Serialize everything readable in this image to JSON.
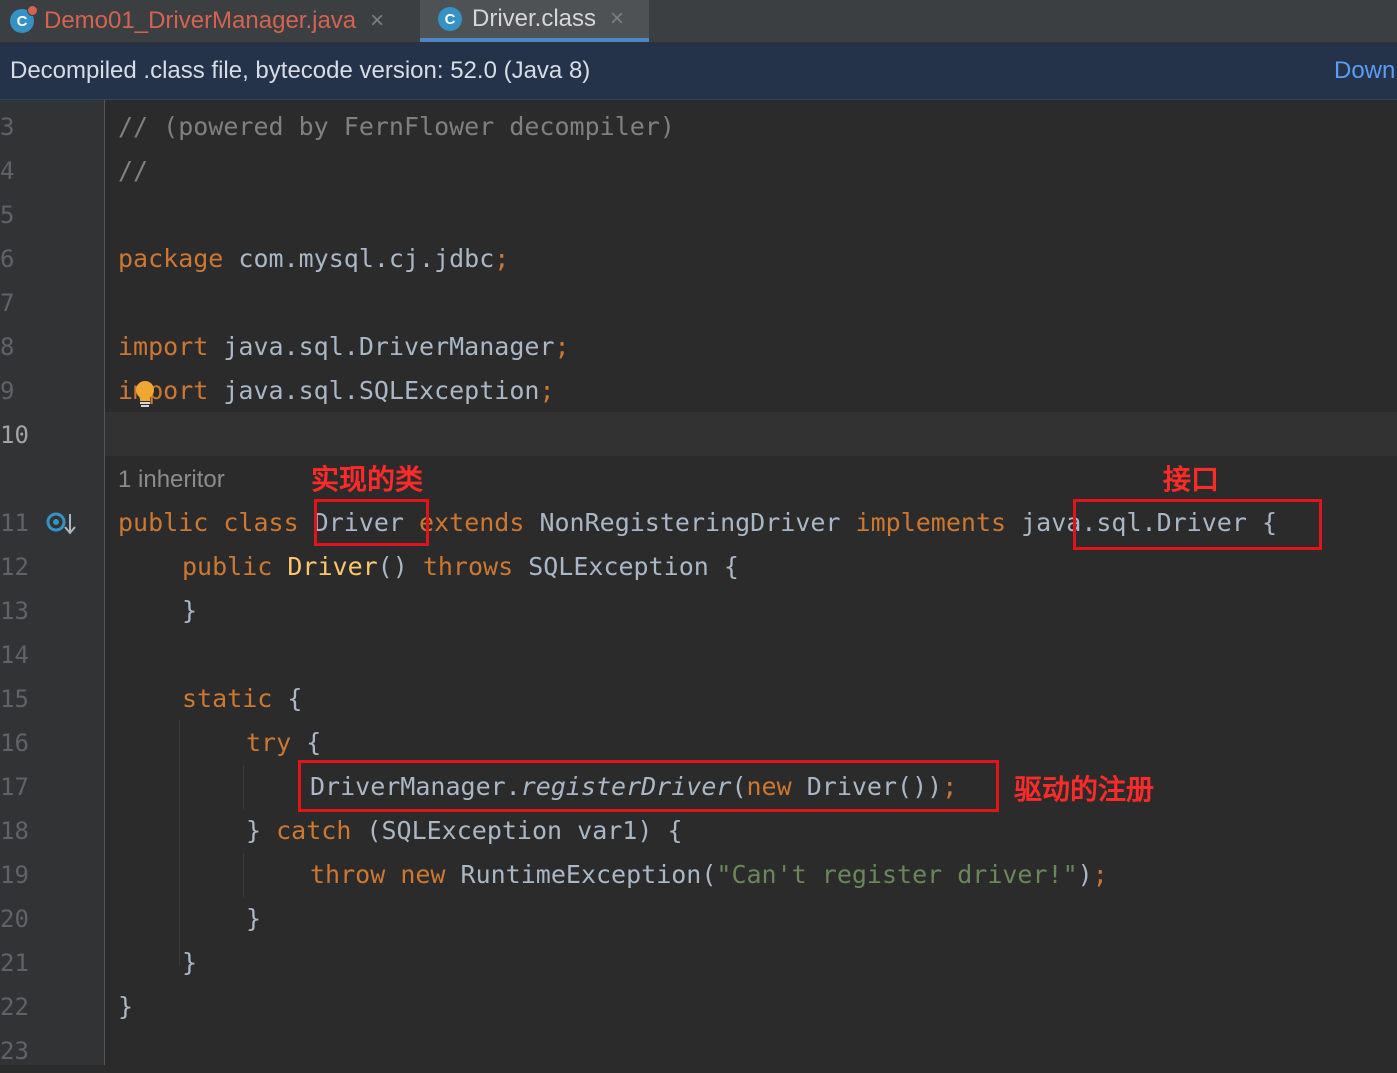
{
  "tabs": [
    {
      "label": "Demo01_DriverManager.java",
      "icon": "java-class-icon",
      "close": "×"
    },
    {
      "label": "Driver.class",
      "icon": "class-icon",
      "close": "×"
    }
  ],
  "banner": {
    "text": "Decompiled .class file, bytecode version: 52.0 (Java 8)",
    "link": "Down"
  },
  "line_numbers": [
    "3",
    "4",
    "5",
    "6",
    "7",
    "8",
    "9",
    "10",
    "11",
    "12",
    "13",
    "14",
    "15",
    "16",
    "17",
    "18",
    "19",
    "20",
    "21",
    "22",
    "23"
  ],
  "inlay_hint": "1 inheritor",
  "annotations": {
    "impl_class": "实现的类",
    "interface": "接口",
    "driver_registration": "驱动的注册"
  },
  "code": {
    "l3_comment": "// (powered by FernFlower decompiler)",
    "l4_comment": "//",
    "l6_kw": "package",
    "l6_rest": " com.mysql.cj.jdbc",
    "l8_kw": "import",
    "l8_rest": " java.sql.DriverManager",
    "l9_kw": "import",
    "l9_rest": " java.sql.SQLException",
    "semi": ";",
    "l11_kw1": "public class ",
    "l11_name": "Driver",
    "l11_kw2": " extends ",
    "l11_super": "NonRegisteringDriver",
    "l11_kw3": " implements ",
    "l11_iface": "java.sql.Driver",
    "l11_tail": " {",
    "l12_kw": "public ",
    "l12_name": "Driver",
    "l12_paren": "() ",
    "l12_throws": "throws ",
    "l12_rest": "SQLException {",
    "close_brace": "}",
    "l15_kw": "static ",
    "open_brace": "{",
    "l16_kw": "try ",
    "l17_cls": "DriverManager.",
    "l17_method": "registerDriver",
    "l17_paren": "(",
    "l17_new": "new ",
    "l17_tail": "Driver())",
    "l18_brace": "} ",
    "l18_catch": "catch ",
    "l18_rest": "(SQLException var1) {",
    "l19_throw": "throw ",
    "l19_new": "new ",
    "l19_cls": "RuntimeException(",
    "l19_str": "\"Can't register driver!\"",
    "l19_tail": ")"
  },
  "colors": {
    "keyword": "#cc7832",
    "comment": "#808080",
    "string": "#6a8759",
    "text": "#a9b7c6",
    "annotation_red": "#e0141a"
  }
}
